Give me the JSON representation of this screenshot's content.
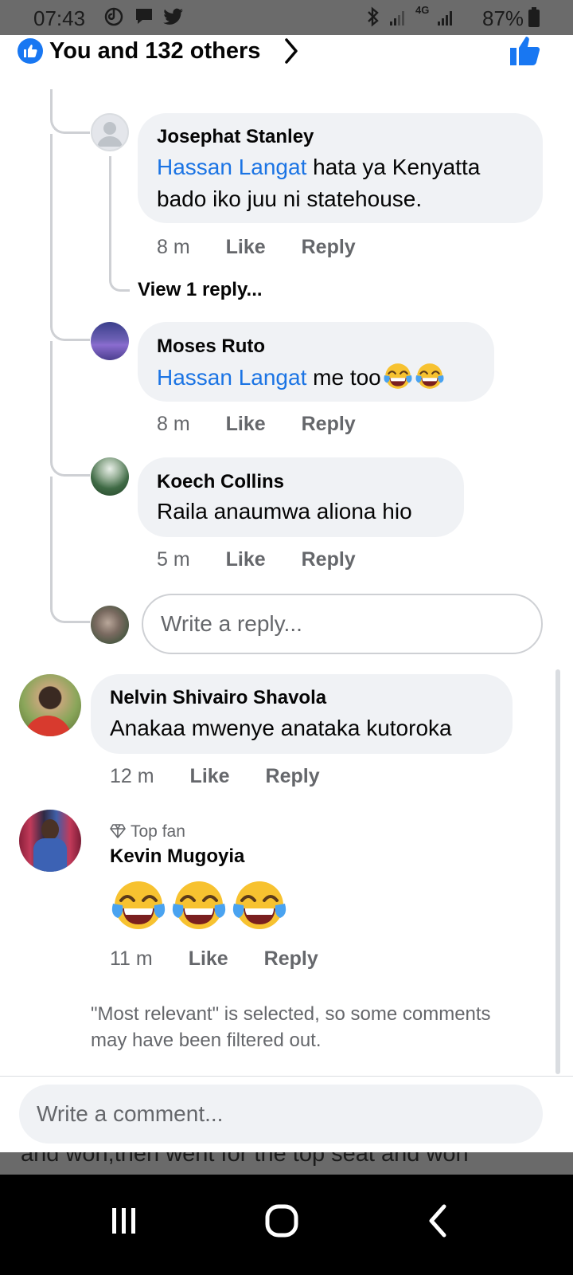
{
  "status_bar": {
    "time": "07:43",
    "network": "4G",
    "battery": "87%"
  },
  "header": {
    "reactions_text": "You and 132 others"
  },
  "comments": [
    {
      "author": "Josephat Stanley",
      "mention": "Hassan Langat",
      "text_line1": " hata ya Kenyatta",
      "text_line2": "bado iko juu ni statehouse.",
      "time": "8 m",
      "like": "Like",
      "reply": "Reply",
      "view_replies": "View 1 reply..."
    },
    {
      "author": "Moses Ruto",
      "mention": "Hassan Langat",
      "text": " me too",
      "emojis": [
        "face-with-tears-of-joy",
        "face-with-tears-of-joy"
      ],
      "time": "8 m",
      "like": "Like",
      "reply": "Reply"
    },
    {
      "author": "Koech Collins",
      "text": "Raila anaumwa aliona hio",
      "time": "5 m",
      "like": "Like",
      "reply": "Reply"
    }
  ],
  "reply_input": {
    "placeholder": "Write a reply..."
  },
  "top_comments": [
    {
      "author": "Nelvin Shivairo Shavola",
      "text": "Anakaa mwenye anataka kutoroka",
      "time": "12 m",
      "like": "Like",
      "reply": "Reply"
    },
    {
      "badge": "Top fan",
      "author": "Kevin Mugoyia",
      "emojis": [
        "face-with-tears-of-joy",
        "face-with-tears-of-joy",
        "face-with-tears-of-joy"
      ],
      "time": "11 m",
      "like": "Like",
      "reply": "Reply"
    }
  ],
  "notice": "\"Most relevant\" is selected, so some comments may have been filtered out.",
  "comment_input": {
    "placeholder": "Write a comment..."
  },
  "background_text": "and won,then went for the top seat and won",
  "colors": {
    "accent": "#1877f2",
    "mention": "#1b74e4",
    "bubble": "#f0f2f5",
    "secondary_text": "#65676b"
  }
}
